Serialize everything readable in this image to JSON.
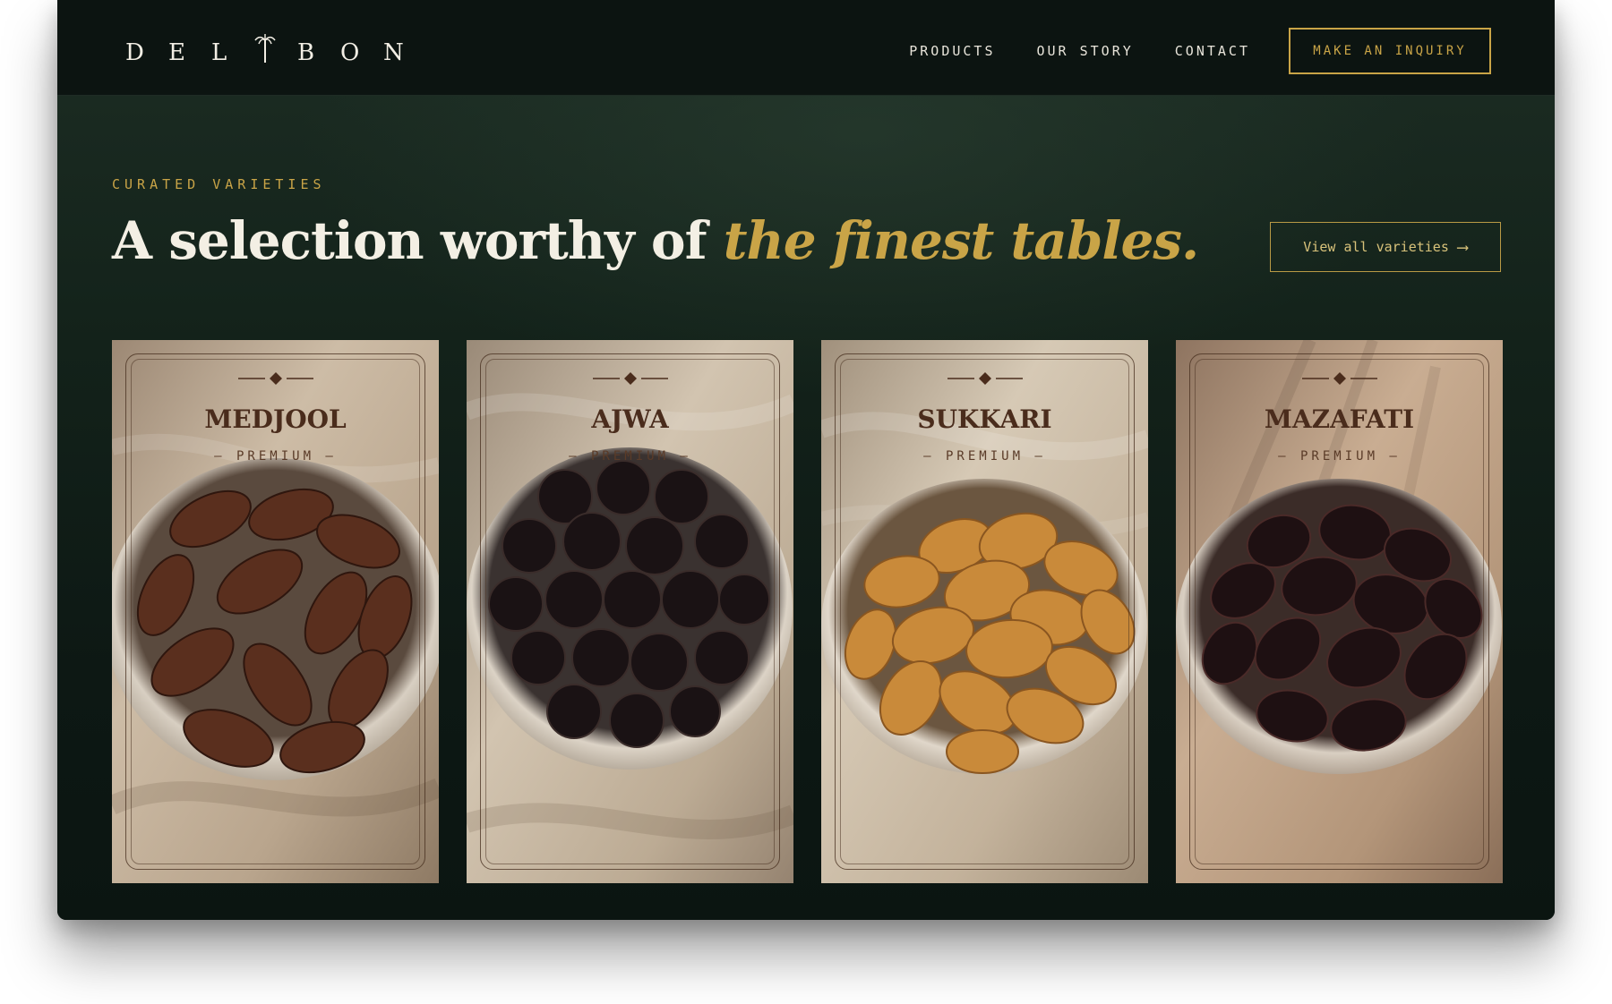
{
  "brand": {
    "letters": [
      "D",
      "E",
      "L",
      "B",
      "O",
      "N"
    ],
    "logo_icon": "palm-tree-icon"
  },
  "nav": {
    "links": [
      "PRODUCTS",
      "OUR STORY",
      "CONTACT"
    ],
    "cta": "MAKE AN INQUIRY"
  },
  "hero": {
    "eyebrow": "CURATED VARIETIES",
    "headline_plain": "A selection worthy of",
    "headline_accent": "the finest tables.",
    "view_all": "View all varieties",
    "view_all_icon": "arrow-right-icon"
  },
  "cards": [
    {
      "name": "MEDJOOL",
      "tier": "– PREMIUM –",
      "date_color": "#5a2f1e",
      "cloth": "#c8b6a0"
    },
    {
      "name": "AJWA",
      "tier": "– PREMIUM –",
      "date_color": "#1a1214",
      "cloth": "#cbbba6"
    },
    {
      "name": "SUKKARI",
      "tier": "– PREMIUM –",
      "date_color": "#c98a3a",
      "cloth": "#cdbda6"
    },
    {
      "name": "MAZAFATI",
      "tier": "– PREMIUM –",
      "date_color": "#1e1012",
      "cloth": "#c0a48a"
    }
  ],
  "colors": {
    "accent_gold": "#c9a447",
    "background": "#0c1612",
    "text_light": "#f3efe4"
  }
}
